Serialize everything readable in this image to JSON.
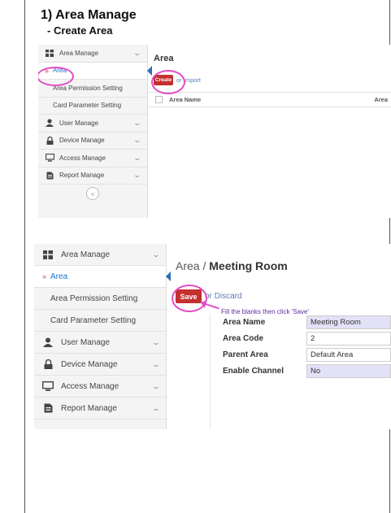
{
  "doc": {
    "title": "1) Area Manage",
    "subtitle": "- Create Area"
  },
  "shot1": {
    "page_title": "Area",
    "create_label": "Create",
    "import_label": "or Import",
    "table_headers": [
      "Area Name",
      "Area"
    ],
    "sidebar": [
      {
        "label": "Area Manage",
        "icon": "grid-icon"
      },
      {
        "label": "Area",
        "active": true
      },
      {
        "label": "Area Permission Setting"
      },
      {
        "label": "Card Parameter Setting"
      },
      {
        "label": "User Manage",
        "icon": "user-icon"
      },
      {
        "label": "Device Manage",
        "icon": "lock-icon"
      },
      {
        "label": "Access Manage",
        "icon": "monitor-icon"
      },
      {
        "label": "Report Manage",
        "icon": "document-icon"
      }
    ],
    "collapse_icon": "«"
  },
  "shot2": {
    "page_title_prefix": "Area / ",
    "page_title": "Meeting Room",
    "save_label": "Save",
    "discard_label": "or Discard",
    "hint": "Fill the blanks then click 'Save'",
    "sidebar": [
      {
        "label": "Area Manage",
        "icon": "grid-icon"
      },
      {
        "label": "Area",
        "active": true
      },
      {
        "label": "Area Permission Setting"
      },
      {
        "label": "Card Parameter Setting"
      },
      {
        "label": "User Manage",
        "icon": "user-icon"
      },
      {
        "label": "Device Manage",
        "icon": "lock-icon"
      },
      {
        "label": "Access Manage",
        "icon": "monitor-icon"
      },
      {
        "label": "Report Manage",
        "icon": "document-icon"
      }
    ],
    "form": [
      {
        "label": "Area Name",
        "value": "Meeting Room"
      },
      {
        "label": "Area Code",
        "value": "2"
      },
      {
        "label": "Parent Area",
        "value": "Default Area"
      },
      {
        "label": "Enable Channel",
        "value": "No"
      }
    ]
  },
  "colors": {
    "accent": "#c42f2f",
    "annotation": "#e24bc6",
    "link": "#1a73c9"
  }
}
